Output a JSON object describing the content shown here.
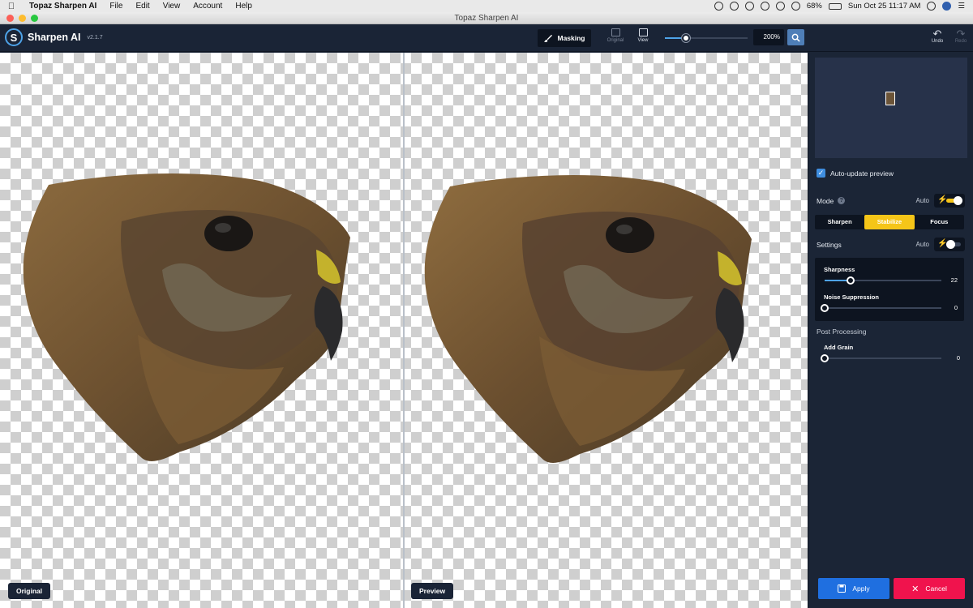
{
  "menubar": {
    "app_name": "Topaz Sharpen AI",
    "menus": [
      "File",
      "Edit",
      "View",
      "Account",
      "Help"
    ],
    "battery": "68%",
    "datetime": "Sun Oct 25  11:17 AM"
  },
  "window": {
    "title": "Topaz Sharpen AI"
  },
  "toolbar": {
    "brand": "Sharpen AI",
    "version": "v2.1.7",
    "masking_label": "Masking",
    "original_label": "Original",
    "view_label": "View",
    "zoom_value": "200%",
    "zoom_slider_fraction": 0.25,
    "undo_label": "Undo",
    "redo_label": "Redo"
  },
  "canvas": {
    "left_label": "Original",
    "right_label": "Preview"
  },
  "panel": {
    "auto_update_label": "Auto-update preview",
    "auto_update_checked": true,
    "mode_label": "Mode",
    "mode_auto_label": "Auto",
    "mode_auto_on": true,
    "modes": [
      "Sharpen",
      "Stabilize",
      "Focus"
    ],
    "active_mode": "Stabilize",
    "settings_label": "Settings",
    "settings_auto_label": "Auto",
    "settings_auto_on": false,
    "sharpness_label": "Sharpness",
    "sharpness_value": "22",
    "sharpness_fraction": 0.22,
    "noise_label": "Noise Suppression",
    "noise_value": "0",
    "noise_fraction": 0,
    "post_processing_label": "Post Processing",
    "grain_label": "Add Grain",
    "grain_value": "0",
    "grain_fraction": 0,
    "apply_label": "Apply",
    "cancel_label": "Cancel"
  },
  "colors": {
    "accent_blue": "#1f6fe0",
    "accent_yellow": "#f5c518",
    "cancel_red": "#f0134d",
    "panel_bg": "#1b2536"
  }
}
